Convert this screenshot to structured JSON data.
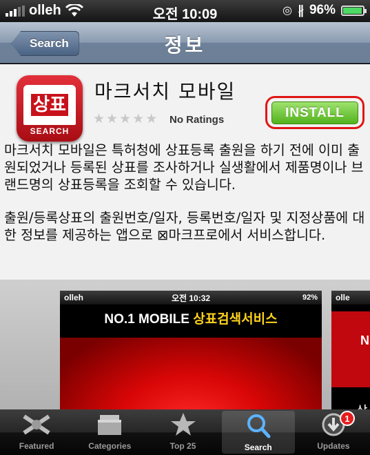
{
  "status_bar": {
    "carrier": "olleh",
    "time": "오전 10:09",
    "battery": "96%",
    "battery_level": 0.96
  },
  "nav": {
    "back_label": "Search",
    "title": "정보"
  },
  "app": {
    "icon_text": "상표",
    "icon_sub": "SEARCH",
    "name": "마크서치 모바일",
    "ratings": "No Ratings",
    "stars": 0,
    "install_label": "INSTALL"
  },
  "description": {
    "paragraph1": "마크서치 모바일은 특허청에 상표등록 출원을 하기 전에 이미 출원되었거나 등록된 상표를 조사하거나 실생활에서 제품명이나 브랜드명의 상표등록을 조회할 수 있습니다.",
    "paragraph2": "출원/등록상표의 출원번호/일자, 등록번호/일자 및 지정상품에 대한 정보를 제공하는 앱으로 ⊠마크프로에서 서비스합니다."
  },
  "screenshots": {
    "shot1": {
      "carrier": "olleh",
      "time": "오전 10:32",
      "battery": "92%",
      "promo_white": "NO.1 MOBILE ",
      "promo_yellow": "상표검색서비스"
    },
    "shot2": {
      "carrier": "olle",
      "letter": "N",
      "korean": "상"
    }
  },
  "tabs": [
    {
      "label": "Featured",
      "icon": "featured-icon"
    },
    {
      "label": "Categories",
      "icon": "categories-icon"
    },
    {
      "label": "Top 25",
      "icon": "star-icon"
    },
    {
      "label": "Search",
      "icon": "search-icon",
      "selected": true
    },
    {
      "label": "Updates",
      "icon": "updates-icon",
      "badge": "1"
    }
  ],
  "colors": {
    "install_green": "#5cbf2a",
    "highlight_red": "#e01515",
    "nav_blue": "#6d819a"
  }
}
